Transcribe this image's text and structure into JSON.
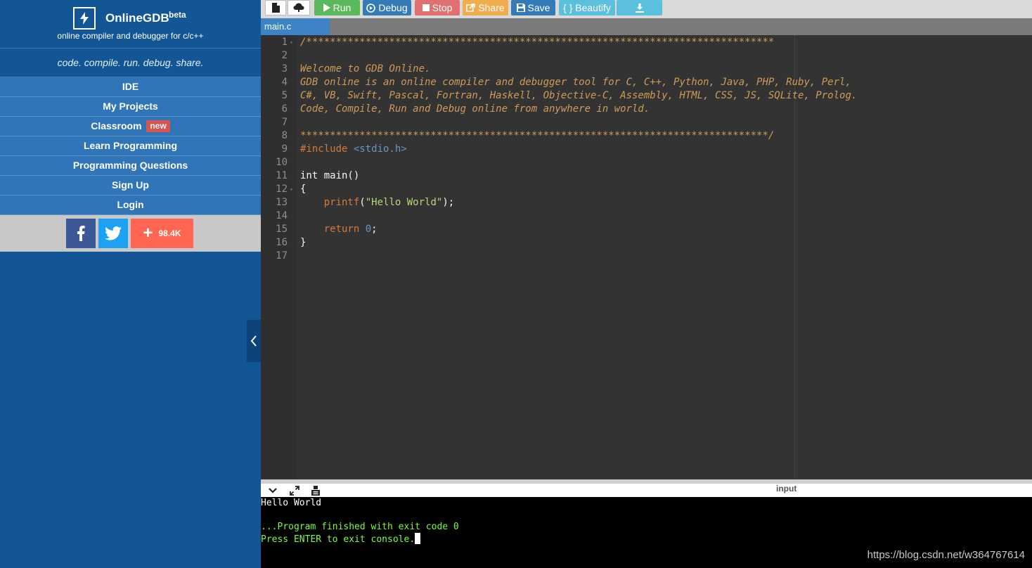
{
  "sidebar": {
    "brand": {
      "name": "OnlineGDB",
      "beta": "beta",
      "tagline": "online compiler and debugger for c/c++"
    },
    "slogan": "code. compile. run. debug. share.",
    "nav": [
      {
        "label": "IDE"
      },
      {
        "label": "My Projects"
      },
      {
        "label": "Classroom",
        "badge": "new"
      },
      {
        "label": "Learn Programming"
      },
      {
        "label": "Programming Questions"
      },
      {
        "label": "Sign Up"
      },
      {
        "label": "Login"
      }
    ],
    "social": {
      "share_count": "98.4K"
    }
  },
  "toolbar": {
    "run": "Run",
    "debug": "Debug",
    "stop": "Stop",
    "share": "Share",
    "save": "Save",
    "beautify": "{ } Beautify"
  },
  "tabs": {
    "active_file": "main.c"
  },
  "editor": {
    "lines": [
      {
        "n": "1",
        "fold": true,
        "parts": [
          {
            "t": "/*******************************************************************************",
            "c": "c-comment"
          }
        ]
      },
      {
        "n": "2",
        "fold": false,
        "parts": []
      },
      {
        "n": "3",
        "fold": false,
        "parts": [
          {
            "t": "Welcome to GDB Online.",
            "c": "c-comment"
          }
        ]
      },
      {
        "n": "4",
        "fold": false,
        "parts": [
          {
            "t": "GDB online is an online compiler and debugger tool for C, C++, Python, Java, PHP, Ruby, Perl,",
            "c": "c-comment"
          }
        ]
      },
      {
        "n": "5",
        "fold": false,
        "parts": [
          {
            "t": "C#, VB, Swift, Pascal, Fortran, Haskell, Objective-C, Assembly, HTML, CSS, JS, SQLite, Prolog.",
            "c": "c-comment"
          }
        ]
      },
      {
        "n": "6",
        "fold": false,
        "parts": [
          {
            "t": "Code, Compile, Run and Debug online from anywhere in world.",
            "c": "c-comment"
          }
        ]
      },
      {
        "n": "7",
        "fold": false,
        "parts": []
      },
      {
        "n": "8",
        "fold": false,
        "parts": [
          {
            "t": "*******************************************************************************/",
            "c": "c-comment"
          }
        ]
      },
      {
        "n": "9",
        "fold": false,
        "parts": [
          {
            "t": "#include ",
            "c": "c-include"
          },
          {
            "t": "<stdio.h>",
            "c": "c-lib"
          }
        ]
      },
      {
        "n": "10",
        "fold": false,
        "parts": []
      },
      {
        "n": "11",
        "fold": false,
        "parts": [
          {
            "t": "int main()",
            "c": "c-plain"
          }
        ]
      },
      {
        "n": "12",
        "fold": true,
        "parts": [
          {
            "t": "{",
            "c": "c-plain"
          }
        ]
      },
      {
        "n": "13",
        "fold": false,
        "parts": [
          {
            "t": "    ",
            "c": "c-plain"
          },
          {
            "t": "printf",
            "c": "c-func"
          },
          {
            "t": "(",
            "c": "c-plain"
          },
          {
            "t": "\"Hello World\"",
            "c": "c-string"
          },
          {
            "t": ");",
            "c": "c-plain"
          }
        ]
      },
      {
        "n": "14",
        "fold": false,
        "parts": []
      },
      {
        "n": "15",
        "fold": false,
        "parts": [
          {
            "t": "    ",
            "c": "c-plain"
          },
          {
            "t": "return",
            "c": "c-kw"
          },
          {
            "t": " ",
            "c": "c-plain"
          },
          {
            "t": "0",
            "c": "c-num"
          },
          {
            "t": ";",
            "c": "c-plain"
          }
        ]
      },
      {
        "n": "16",
        "fold": false,
        "parts": [
          {
            "t": "}",
            "c": "c-plain"
          }
        ]
      },
      {
        "n": "17",
        "fold": false,
        "parts": []
      }
    ]
  },
  "console": {
    "input_label": "input",
    "output": [
      {
        "text": "Hello World",
        "style": "out-white"
      },
      {
        "text": "",
        "style": "out-white"
      },
      {
        "text": "...Program finished with exit code 0",
        "style": "out-green"
      },
      {
        "text": "Press ENTER to exit console.",
        "style": "out-green",
        "cursor": true
      }
    ]
  },
  "watermark": "https://blog.csdn.net/w364767614",
  "colors": {
    "sidebar_bg": "#135695",
    "nav_bg": "#2f75b8",
    "run": "#5cb85c",
    "debug": "#337ab7",
    "stop": "#e07070",
    "share": "#f0ad4e",
    "beautify": "#5bc0de",
    "editor_bg": "#333333",
    "console_bg": "#000000"
  },
  "icons": [
    "lightning-bolt-icon",
    "new-file-icon",
    "upload-icon",
    "play-icon",
    "debug-icon",
    "stop-icon",
    "share-icon",
    "save-icon",
    "download-icon",
    "facebook-icon",
    "twitter-icon",
    "plus-icon",
    "chevron-left-icon",
    "chevron-down-icon",
    "expand-icon",
    "stdin-icon"
  ]
}
